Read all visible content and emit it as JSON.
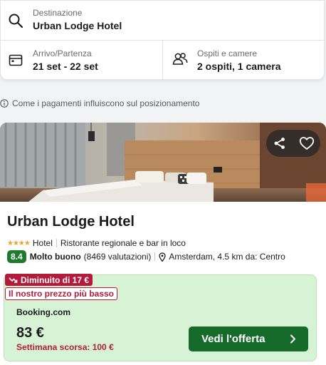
{
  "search": {
    "destination_label": "Destinazione",
    "destination_value": "Urban Lodge Hotel",
    "dates_label": "Arrivo/Partenza",
    "dates_value": "21 set - 22 set",
    "guests_label": "Ospiti e camere",
    "guests_value": "2 ospiti, 1 camera",
    "icons": {
      "search": "search-icon",
      "calendar": "calendar-icon",
      "guests": "guests-icon"
    }
  },
  "info": {
    "text": "Come i pagamenti influiscono sul posizionamento",
    "icon": "info-icon"
  },
  "result": {
    "name": "Urban Lodge Hotel",
    "stars": "★★★★",
    "type": "Hotel",
    "features": "Ristorante regionale e bar in loco",
    "score": "8.4",
    "rating_word": "Molto buono",
    "reviews": "(8469 valutazioni)",
    "location": "Amsterdam, 4.5 km da: Centro",
    "actions": {
      "share": "share-icon",
      "favorite": "heart-icon"
    },
    "offer": {
      "drop_tag": "Diminuito di 17 €",
      "best_price_tag": "Il nostro prezzo più basso",
      "provider": "Booking.com",
      "price": "83 €",
      "last_week": "Settimana scorsa: 100 €",
      "cta_label": "Vedi l'offerta"
    }
  },
  "colors": {
    "accent_green": "#166a2a",
    "score_green": "#1f7a2e",
    "offer_bg": "#d7f3d6",
    "alert_red": "#b21b3c",
    "star": "#f2a22c"
  }
}
